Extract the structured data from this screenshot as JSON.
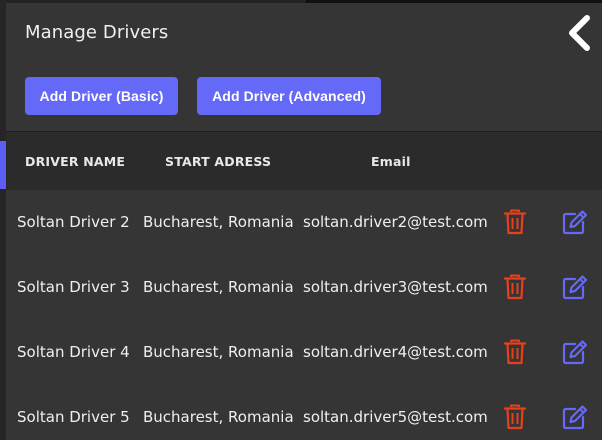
{
  "header": {
    "title": "Manage Drivers",
    "back_icon": "chevron-left-icon"
  },
  "actions": {
    "add_basic_label": "Add Driver (Basic)",
    "add_advanced_label": "Add Driver (Advanced)"
  },
  "table": {
    "columns": [
      "DRIVER NAME",
      "START ADRESS",
      "Email"
    ],
    "rows": [
      {
        "name": "Soltan Driver 2",
        "address": "Bucharest, Romania",
        "email": "soltan.driver2@test.com"
      },
      {
        "name": "Soltan Driver 3",
        "address": "Bucharest, Romania",
        "email": "soltan.driver3@test.com"
      },
      {
        "name": "Soltan Driver 4",
        "address": "Bucharest, Romania",
        "email": "soltan.driver4@test.com"
      },
      {
        "name": "Soltan Driver 5",
        "address": "Bucharest, Romania",
        "email": "soltan.driver5@test.com"
      }
    ],
    "row_icons": {
      "delete": "trash-icon",
      "edit": "edit-icon"
    }
  },
  "colors": {
    "accent": "#6469f7",
    "delete": "#e8401c",
    "edit": "#6469f7",
    "background": "#353535",
    "header_row": "#2b2b2b"
  }
}
